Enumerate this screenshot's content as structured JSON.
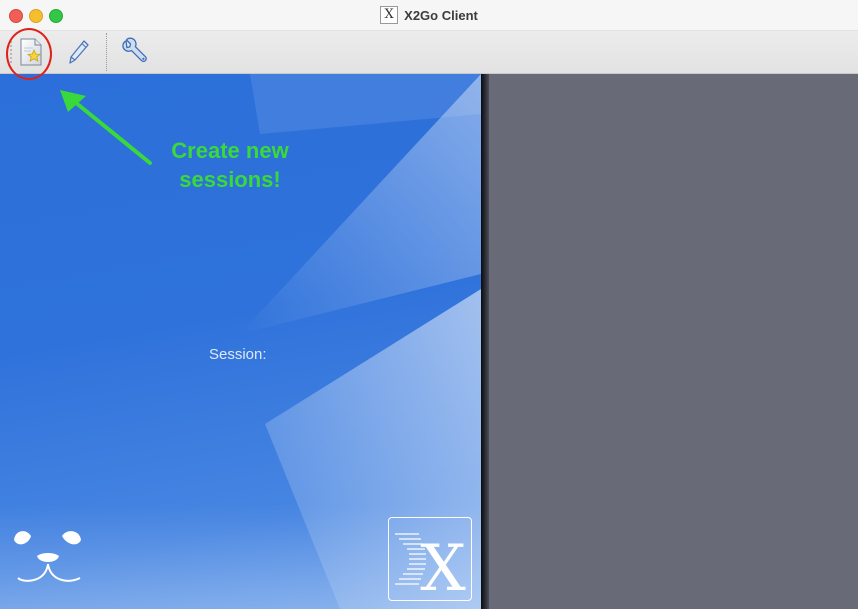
{
  "window": {
    "title": "X2Go Client",
    "title_icon_glyph": "X"
  },
  "toolbar": {
    "buttons": [
      {
        "name": "new-session",
        "icon": "new-session-icon"
      },
      {
        "name": "edit-session",
        "icon": "pencil-icon"
      },
      {
        "name": "preferences",
        "icon": "wrench-icon"
      }
    ]
  },
  "session_pane": {
    "session_label": "Session:",
    "annotation_line1": "Create new",
    "annotation_line2": "sessions!",
    "logo_glyph": "X"
  },
  "colors": {
    "annotation_text": "#39d93b",
    "highlight_circle": "#e0211a",
    "left_pane_blue": "#2c6fda",
    "right_pane": "#696a78"
  }
}
